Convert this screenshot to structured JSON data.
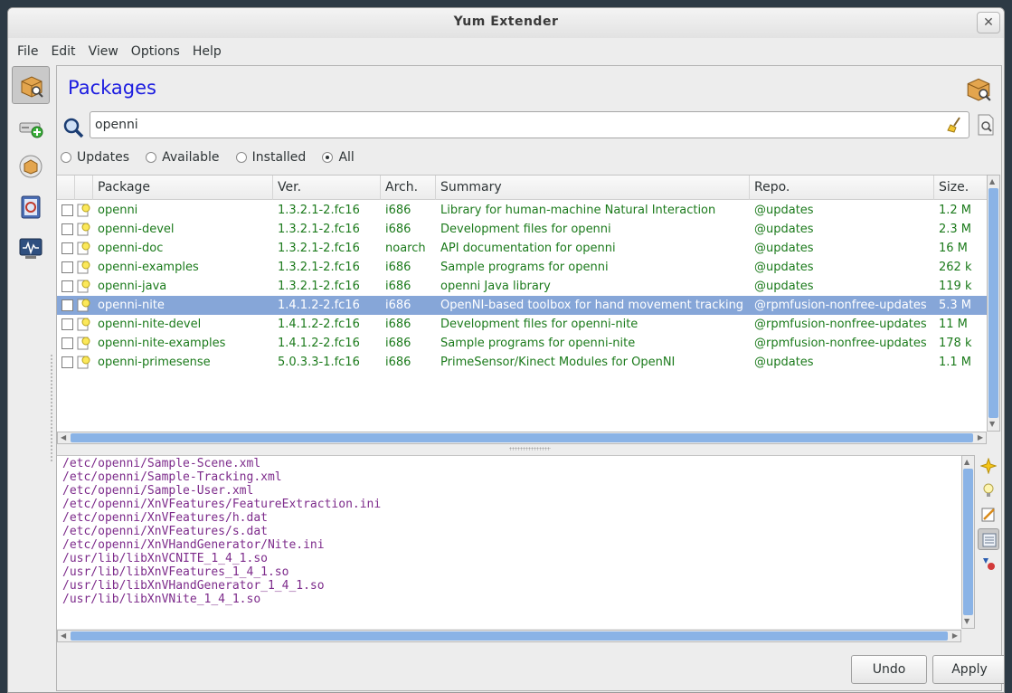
{
  "window": {
    "title": "Yum Extender",
    "close_glyph": "✕"
  },
  "menu": [
    "File",
    "Edit",
    "View",
    "Options",
    "Help"
  ],
  "sidebar": [
    {
      "icon": "packages-icon",
      "active": true
    },
    {
      "icon": "add-repo-icon",
      "active": false
    },
    {
      "icon": "groups-icon",
      "active": false
    },
    {
      "icon": "queue-icon",
      "active": false
    },
    {
      "icon": "history-icon",
      "active": false
    }
  ],
  "page": {
    "title": "Packages"
  },
  "search": {
    "value": "openni"
  },
  "filters": {
    "options": [
      "Updates",
      "Available",
      "Installed",
      "All"
    ],
    "selected": "All"
  },
  "table": {
    "columns": [
      "Package",
      "Ver.",
      "Arch.",
      "Summary",
      "Repo.",
      "Size."
    ],
    "rows": [
      {
        "name": "openni",
        "ver": "1.3.2.1-2.fc16",
        "arch": "i686",
        "summary": "Library for human-machine Natural Interaction",
        "repo": "@updates",
        "size": "1.2 M",
        "selected": false
      },
      {
        "name": "openni-devel",
        "ver": "1.3.2.1-2.fc16",
        "arch": "i686",
        "summary": "Development files for openni",
        "repo": "@updates",
        "size": "2.3 M",
        "selected": false
      },
      {
        "name": "openni-doc",
        "ver": "1.3.2.1-2.fc16",
        "arch": "noarch",
        "summary": "API documentation for openni",
        "repo": "@updates",
        "size": "16 M",
        "selected": false
      },
      {
        "name": "openni-examples",
        "ver": "1.3.2.1-2.fc16",
        "arch": "i686",
        "summary": "Sample programs for openni",
        "repo": "@updates",
        "size": "262 k",
        "selected": false
      },
      {
        "name": "openni-java",
        "ver": "1.3.2.1-2.fc16",
        "arch": "i686",
        "summary": "openni Java library",
        "repo": "@updates",
        "size": "119 k",
        "selected": false
      },
      {
        "name": "openni-nite",
        "ver": "1.4.1.2-2.fc16",
        "arch": "i686",
        "summary": "OpenNI-based toolbox for hand movement tracking",
        "repo": "@rpmfusion-nonfree-updates",
        "size": "5.3 M",
        "selected": true
      },
      {
        "name": "openni-nite-devel",
        "ver": "1.4.1.2-2.fc16",
        "arch": "i686",
        "summary": "Development files for openni-nite",
        "repo": "@rpmfusion-nonfree-updates",
        "size": "11 M",
        "selected": false
      },
      {
        "name": "openni-nite-examples",
        "ver": "1.4.1.2-2.fc16",
        "arch": "i686",
        "summary": "Sample programs for openni-nite",
        "repo": "@rpmfusion-nonfree-updates",
        "size": "178 k",
        "selected": false
      },
      {
        "name": "openni-primesense",
        "ver": "5.0.3.3-1.fc16",
        "arch": "i686",
        "summary": "PrimeSensor/Kinect Modules for OpenNI",
        "repo": "@updates",
        "size": "1.1 M",
        "selected": false
      }
    ]
  },
  "files": [
    "/etc/openni/Sample-Scene.xml",
    "/etc/openni/Sample-Tracking.xml",
    "/etc/openni/Sample-User.xml",
    "/etc/openni/XnVFeatures/FeatureExtraction.ini",
    "/etc/openni/XnVFeatures/h.dat",
    "/etc/openni/XnVFeatures/s.dat",
    "/etc/openni/XnVHandGenerator/Nite.ini",
    "/usr/lib/libXnVCNITE_1_4_1.so",
    "/usr/lib/libXnVFeatures_1_4_1.so",
    "/usr/lib/libXnVHandGenerator_1_4_1.so",
    "/usr/lib/libXnVNite_1_4_1.so"
  ],
  "info_tools": [
    {
      "icon": "description-icon",
      "active": false
    },
    {
      "icon": "update-info-icon",
      "active": false
    },
    {
      "icon": "changelog-icon",
      "active": false
    },
    {
      "icon": "filelist-icon",
      "active": true
    },
    {
      "icon": "dependencies-icon",
      "active": false
    }
  ],
  "buttons": {
    "undo": "Undo",
    "apply": "Apply"
  },
  "colors": {
    "accent": "#1c1ce0",
    "selection": "#86a6d8",
    "package_text": "#1b7a1b",
    "file_text": "#7d2b8b"
  }
}
